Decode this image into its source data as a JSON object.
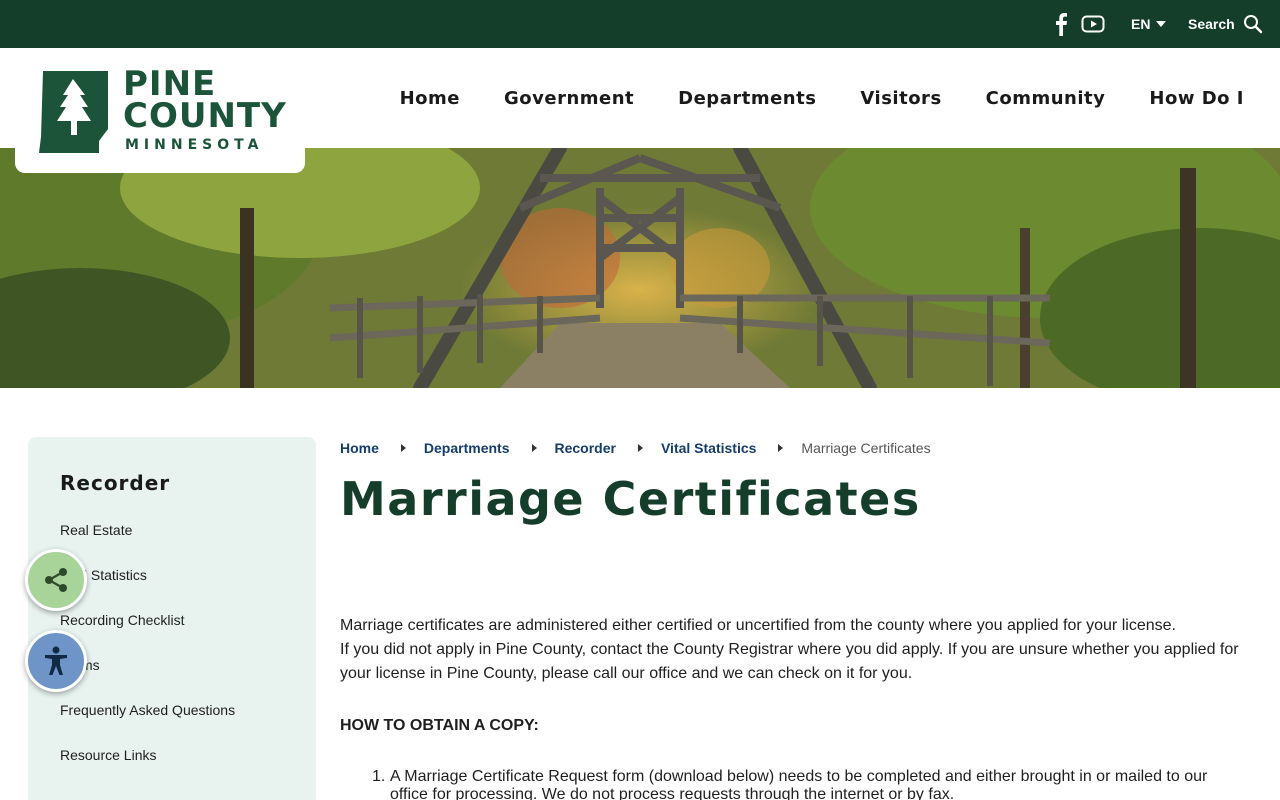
{
  "topbar": {
    "facebook_icon": "facebook-icon",
    "youtube_icon": "youtube-icon",
    "language": "EN",
    "search_label": "Search"
  },
  "logo": {
    "line1": "PINE",
    "line2": "COUNTY",
    "line3": "MINNESOTA",
    "color": "#1b5438"
  },
  "nav": {
    "items": [
      "Home",
      "Government",
      "Departments",
      "Visitors",
      "Community",
      "How Do I"
    ]
  },
  "sidebar": {
    "title": "Recorder",
    "items": [
      "Real Estate",
      "Vital Statistics",
      "Recording Checklist",
      "Forms",
      "Frequently Asked Questions",
      "Resource Links"
    ]
  },
  "breadcrumb": {
    "items": [
      "Home",
      "Departments",
      "Recorder",
      "Vital Statistics"
    ],
    "current": "Marriage Certificates"
  },
  "main": {
    "title": "Marriage Certificates",
    "paragraph1": "Marriage certificates are administered either certified or uncertified from the county where you applied for your license.",
    "paragraph2": "If you did not apply in Pine County, contact the County Registrar where you did apply. If you are unsure whether you applied for your license in Pine County, please call our office and we can check on it for you.",
    "section_heading": "HOW TO OBTAIN A COPY:",
    "step1_number": "1.",
    "step1": "A Marriage Certificate Request form (download below) needs to be completed and either brought in or mailed to our office for processing. We do not process requests through the internet or by fax."
  },
  "colors": {
    "topbar": "#143d2a",
    "title": "#143d2a",
    "link": "#143d6b",
    "sidebar_bg": "#e8f3f0",
    "share_button": "#a8d49a",
    "accessibility_button": "#6f95c8"
  }
}
